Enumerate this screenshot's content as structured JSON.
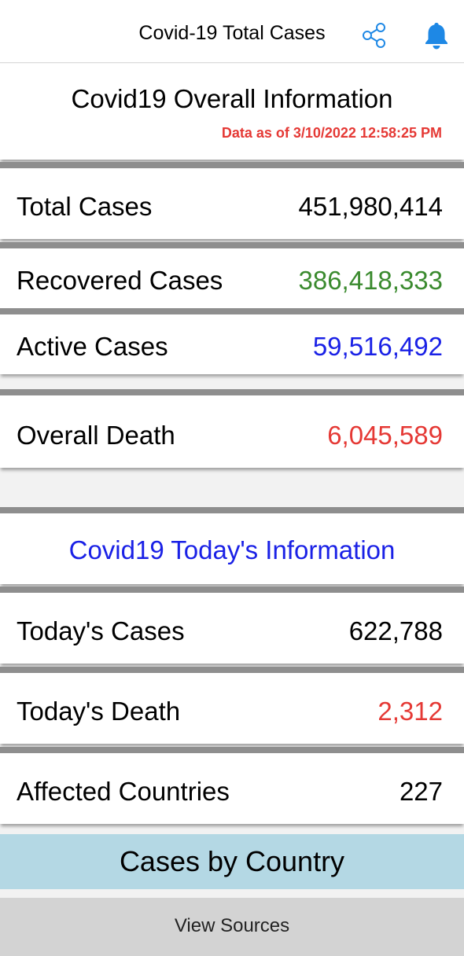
{
  "header": {
    "title": "Covid-19 Total Cases",
    "share_icon": "share-icon",
    "notification_icon": "bell-icon"
  },
  "overall": {
    "title": "Covid19 Overall Information",
    "data_as_of": "Data as of 3/10/2022 12:58:25 PM",
    "rows": [
      {
        "label": "Total Cases",
        "value": "451,980,414",
        "color": "#000000"
      },
      {
        "label": "Recovered Cases",
        "value": "386,418,333",
        "color": "#3a8a2e"
      },
      {
        "label": "Active Cases",
        "value": "59,516,492",
        "color": "#1a21e6"
      },
      {
        "label": "Overall Death",
        "value": "6,045,589",
        "color": "#e53935"
      }
    ]
  },
  "today": {
    "title": "Covid19 Today's Information",
    "rows": [
      {
        "label": "Today's Cases",
        "value": "622,788",
        "color": "#000000"
      },
      {
        "label": "Today's Death",
        "value": "2,312",
        "color": "#e53935"
      },
      {
        "label": "Affected Countries",
        "value": "227",
        "color": "#000000"
      }
    ]
  },
  "buttons": {
    "cases_by_country": "Cases by Country",
    "view_sources": "View Sources"
  },
  "colors": {
    "accent_blue": "#1a21e6",
    "icon_blue": "#1e88e5",
    "red": "#e53935",
    "green": "#3a8a2e",
    "country_button_bg": "#b4d8e4",
    "sources_button_bg": "#d3d3d3"
  }
}
